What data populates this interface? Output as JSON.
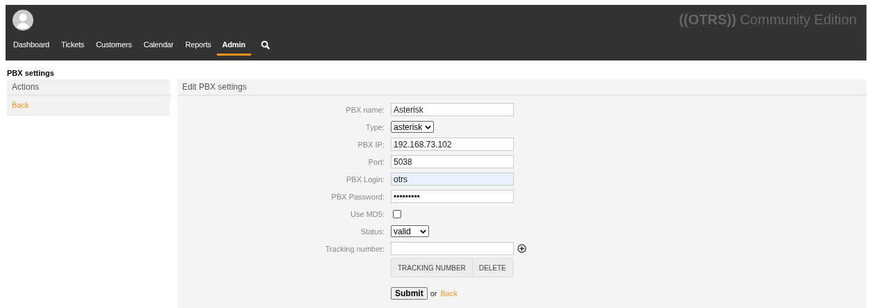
{
  "header": {
    "logo": {
      "mark": "((OTRS))",
      "text": "Community Edition"
    },
    "nav": [
      {
        "label": "Dashboard",
        "selected": false
      },
      {
        "label": "Tickets",
        "selected": false
      },
      {
        "label": "Customers",
        "selected": false
      },
      {
        "label": "Calendar",
        "selected": false
      },
      {
        "label": "Reports",
        "selected": false
      },
      {
        "label": "Admin",
        "selected": true
      }
    ]
  },
  "page_title": "PBX settings",
  "sidebar": {
    "title": "Actions",
    "links": [
      "Back"
    ]
  },
  "main": {
    "title": "Edit PBX settings",
    "fields": [
      {
        "kind": "text",
        "label": "PBX name:",
        "value": "Asterisk",
        "highlighted": false
      },
      {
        "kind": "select",
        "label": "Type:",
        "value": "asterisk"
      },
      {
        "kind": "text",
        "label": "PBX IP:",
        "value": "192.168.73.102",
        "highlighted": false
      },
      {
        "kind": "text",
        "label": "Port:",
        "value": "5038",
        "highlighted": false
      },
      {
        "kind": "text",
        "label": "PBX Login:",
        "value": "otrs",
        "highlighted": true
      },
      {
        "kind": "password",
        "label": "PBX Password:",
        "value": "•••••••••",
        "highlighted": false
      },
      {
        "kind": "checkbox",
        "label": "Use MD5:",
        "checked": false
      },
      {
        "kind": "select",
        "label": "Status:",
        "value": "valid"
      },
      {
        "kind": "tracking",
        "label": "Tracking number:",
        "columns": [
          "TRACKING NUMBER",
          "DELETE"
        ]
      }
    ],
    "submit": "Submit",
    "or": "or",
    "back": "Back"
  }
}
